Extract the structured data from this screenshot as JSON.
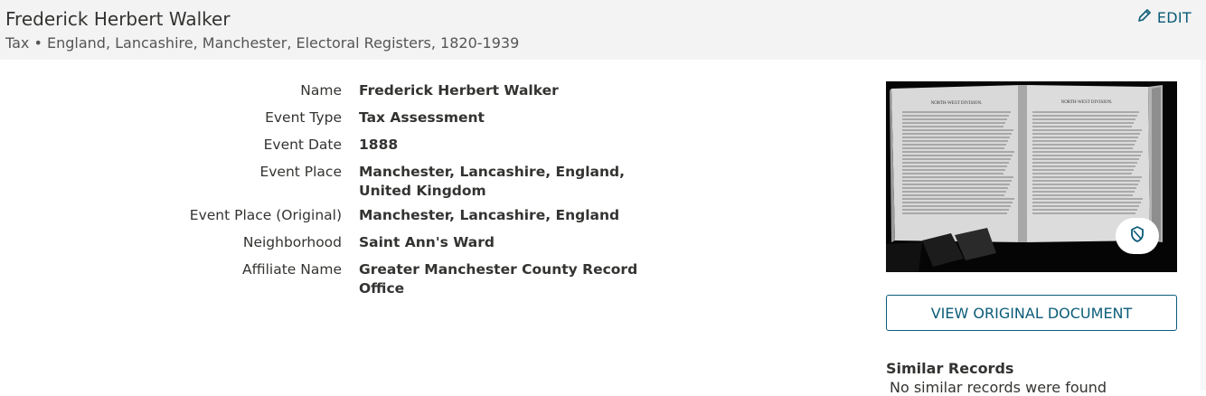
{
  "header": {
    "title": "Frederick Herbert Walker",
    "subtitle": "Tax • England, Lancashire, Manchester, Electoral Registers, 1820-1939",
    "edit_label": "EDIT"
  },
  "facts": [
    {
      "label": "Name",
      "value": "Frederick Herbert Walker"
    },
    {
      "label": "Event Type",
      "value": "Tax Assessment"
    },
    {
      "label": "Event Date",
      "value": "1888"
    },
    {
      "label": "Event Place",
      "value": "Manchester, Lancashire, England, United Kingdom"
    },
    {
      "label": "Event Place (Original)",
      "value": "Manchester, Lancashire, England"
    },
    {
      "label": "Neighborhood",
      "value": "Saint Ann's Ward"
    },
    {
      "label": "Affiliate Name",
      "value": "Greater Manchester County Record Office"
    }
  ],
  "document": {
    "view_button_label": "VIEW ORIGINAL DOCUMENT",
    "page_left_heading": "NORTH-WEST DIVISION.",
    "page_right_heading": "NORTH-WEST DIVISION."
  },
  "similar": {
    "title": "Similar Records",
    "empty_text": " No similar records were found"
  },
  "colors": {
    "accent": "#0b5c79",
    "header_bg": "#f3f3f3",
    "text": "#333331"
  }
}
